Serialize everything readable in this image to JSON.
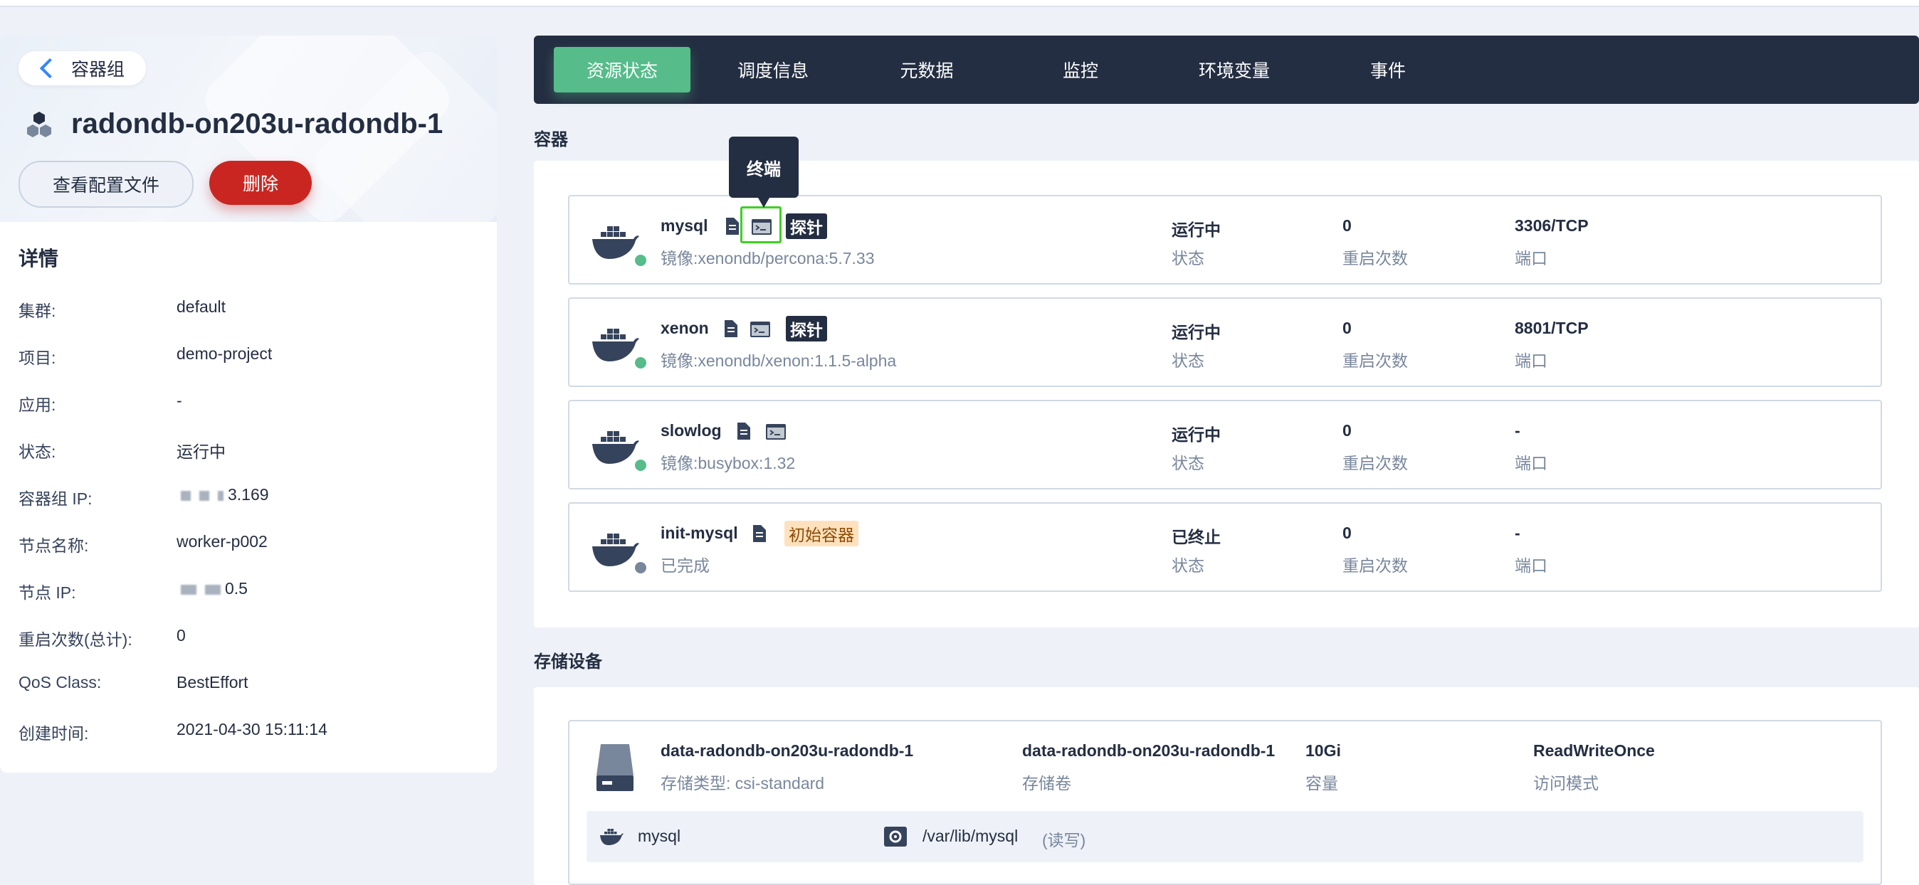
{
  "back": {
    "label": "容器组"
  },
  "pod": {
    "name": "radondb-on203u-radondb-1"
  },
  "actions": {
    "view_yaml": "查看配置文件",
    "delete": "删除"
  },
  "details": {
    "title": "详情",
    "items": [
      {
        "key": "集群:",
        "value": "default"
      },
      {
        "key": "项目:",
        "value": "demo-project"
      },
      {
        "key": "应用:",
        "value": "-"
      },
      {
        "key": "状态:",
        "value": "运行中"
      },
      {
        "key": "容器组 IP:",
        "value": "3.169"
      },
      {
        "key": "节点名称:",
        "value": "worker-p002"
      },
      {
        "key": "节点 IP:",
        "value": "0.5"
      },
      {
        "key": "重启次数(总计):",
        "value": "0"
      },
      {
        "key": "QoS Class:",
        "value": "BestEffort"
      },
      {
        "key": "创建时间:",
        "value": "2021-04-30 15:11:14"
      }
    ]
  },
  "tabs": [
    "资源状态",
    "调度信息",
    "元数据",
    "监控",
    "环境变量",
    "事件"
  ],
  "sections": {
    "containers": "容器",
    "storage": "存储设备"
  },
  "tooltip": "终端",
  "containers": [
    {
      "name": "mysql",
      "sub": "镜像:xenondb/percona:5.7.33",
      "tag": "探针",
      "status": "运行中",
      "status_label": "状态",
      "restarts": "0",
      "restarts_label": "重启次数",
      "port": "3306/TCP",
      "port_label": "端口",
      "state_color": "#55bc8a"
    },
    {
      "name": "xenon",
      "sub": "镜像:xenondb/xenon:1.1.5-alpha",
      "tag": "探针",
      "status": "运行中",
      "status_label": "状态",
      "restarts": "0",
      "restarts_label": "重启次数",
      "port": "8801/TCP",
      "port_label": "端口",
      "state_color": "#55bc8a"
    },
    {
      "name": "slowlog",
      "sub": "镜像:busybox:1.32",
      "tag": "",
      "status": "运行中",
      "status_label": "状态",
      "restarts": "0",
      "restarts_label": "重启次数",
      "port": "-",
      "port_label": "端口",
      "state_color": "#55bc8a"
    },
    {
      "name": "init-mysql",
      "sub": "已完成",
      "tag": "初始容器",
      "status": "已终止",
      "status_label": "状态",
      "restarts": "0",
      "restarts_label": "重启次数",
      "port": "-",
      "port_label": "端口",
      "state_color": "#79879c"
    }
  ],
  "storage": {
    "name": "data-radondb-on203u-radondb-1",
    "type": "存储类型: csi-standard",
    "volume": "data-radondb-on203u-radondb-1",
    "volume_label": "存储卷",
    "capacity": "10Gi",
    "capacity_label": "容量",
    "access": "ReadWriteOnce",
    "access_label": "访问模式",
    "mount": {
      "container": "mysql",
      "path": "/var/lib/mysql",
      "mode": "(读写)"
    }
  },
  "icons": {
    "back": "chevron-left-icon",
    "pod": "pod-cluster-icon",
    "container": "docker-whale-icon",
    "log": "document-icon",
    "terminal": "terminal-icon",
    "disk": "disk-icon",
    "mount": "mount-icon"
  },
  "colors": {
    "primary_dark": "#242e42",
    "success": "#55bc8a",
    "danger": "#ca2621",
    "highlight": "#3ed022",
    "init_tag_bg": "#ffe1be"
  }
}
